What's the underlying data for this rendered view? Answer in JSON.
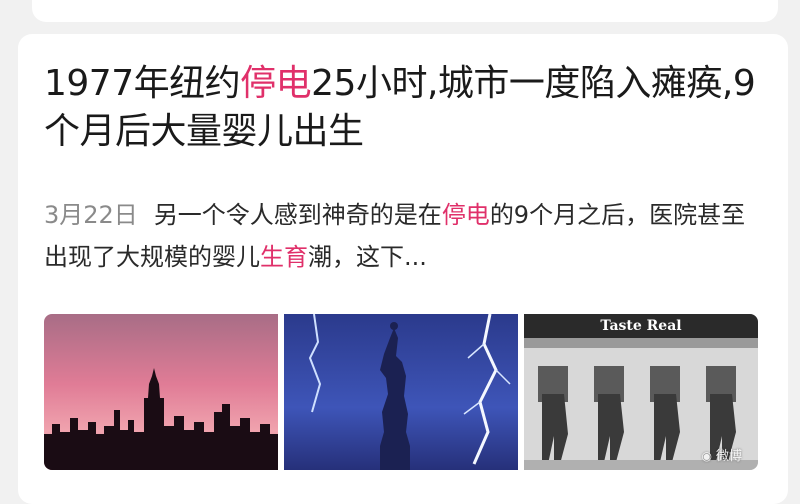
{
  "article": {
    "title_parts": [
      {
        "text": "1977年纽约",
        "hl": false
      },
      {
        "text": "停电",
        "hl": true
      },
      {
        "text": "25小时,城市一度陷入瘫痪,9个月后大量婴儿出生",
        "hl": false
      }
    ],
    "date": "3月22日",
    "summary_parts": [
      {
        "text": "另一个令人感到神奇的是在",
        "hl": false
      },
      {
        "text": "停电",
        "hl": true
      },
      {
        "text": "的9个月之后，医院甚至出现了大规模的婴儿",
        "hl": false
      },
      {
        "text": "生育",
        "hl": true
      },
      {
        "text": "潮，这下...",
        "hl": false
      }
    ],
    "thumbnails": [
      {
        "name": "city-skyline-thumbnail"
      },
      {
        "name": "statue-of-liberty-lightning-thumbnail"
      },
      {
        "name": "taste-real-thumbnail",
        "label": "Taste Real"
      }
    ],
    "watermark": "微博"
  },
  "colors": {
    "highlight": "#e0306a",
    "date": "#8a8a8a",
    "background": "#f1f1f1"
  },
  "icons": {
    "watermark": "weibo-icon"
  }
}
